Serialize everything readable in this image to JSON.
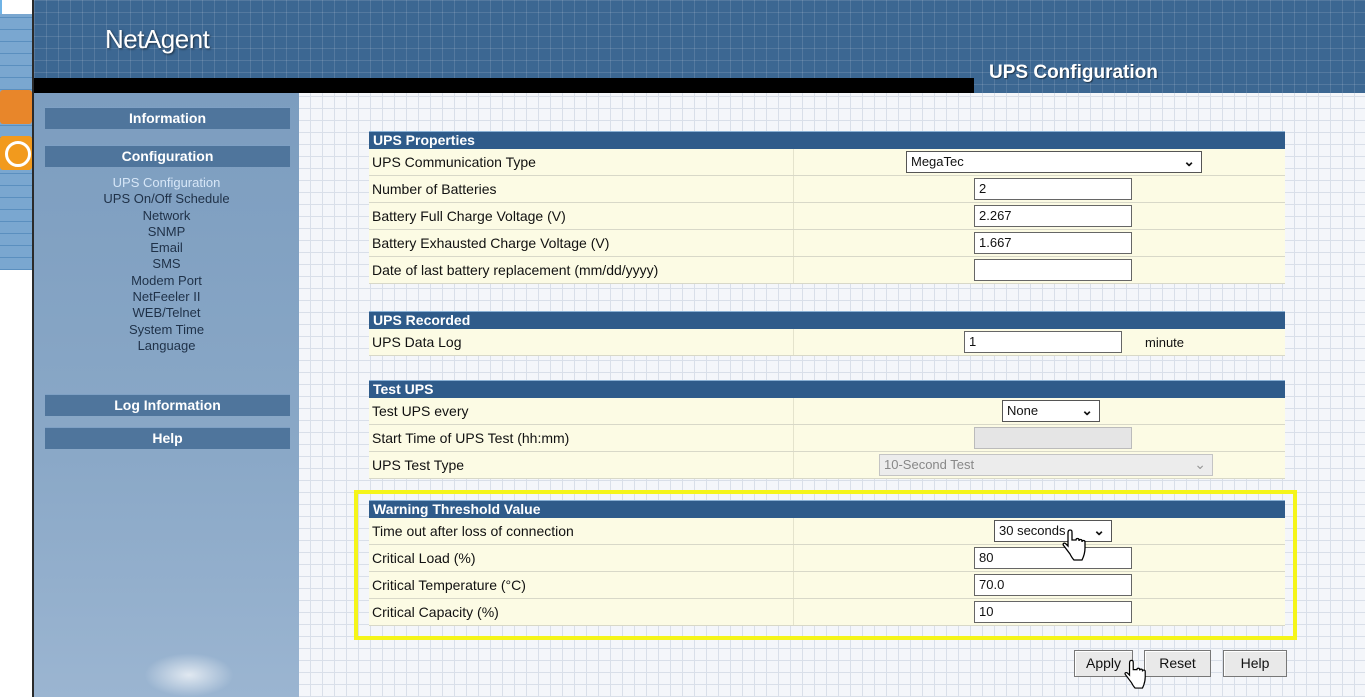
{
  "app": {
    "logo": "NetAgent",
    "page_title": "UPS Configuration"
  },
  "sidebar": {
    "headers": {
      "information": "Information",
      "configuration": "Configuration",
      "log_information": "Log Information",
      "help": "Help"
    },
    "config_links": [
      "UPS Configuration",
      "UPS On/Off Schedule",
      "Network",
      "SNMP",
      "Email",
      "SMS",
      "Modem Port",
      "NetFeeler II",
      "WEB/Telnet",
      "System Time",
      "Language"
    ],
    "active_link": "UPS Configuration"
  },
  "ups_properties": {
    "title": "UPS Properties",
    "communication_type_label": "UPS Communication Type",
    "communication_type_value": "MegaTec",
    "num_batteries_label": "Number of Batteries",
    "num_batteries_value": "2",
    "full_charge_label": "Battery Full Charge Voltage (V)",
    "full_charge_value": "2.267",
    "exhausted_label": "Battery Exhausted Charge Voltage (V)",
    "exhausted_value": "1.667",
    "replacement_date_label": "Date of last battery replacement (mm/dd/yyyy)",
    "replacement_date_value": ""
  },
  "ups_recorded": {
    "title": "UPS Recorded",
    "data_log_label": "UPS Data Log",
    "data_log_value": "1",
    "data_log_unit": "minute"
  },
  "test_ups": {
    "title": "Test UPS",
    "every_label": "Test UPS every",
    "every_value": "None",
    "start_time_label": "Start Time of UPS Test (hh:mm)",
    "start_time_value": "",
    "test_type_label": "UPS Test Type",
    "test_type_value": "10-Second Test"
  },
  "warning_threshold": {
    "title": "Warning Threshold Value",
    "timeout_label": "Time out after loss of connection",
    "timeout_value": "30 seconds",
    "critical_load_label": "Critical Load (%)",
    "critical_load_value": "80",
    "critical_temp_label": "Critical Temperature (°C)",
    "critical_temp_value": "70.0",
    "critical_capacity_label": "Critical Capacity (%)",
    "critical_capacity_value": "10"
  },
  "buttons": {
    "apply": "Apply",
    "reset": "Reset",
    "help": "Help"
  },
  "colors": {
    "header": "#3c6792",
    "section_head": "#2f5b8a",
    "row_bg": "#fcfbe4",
    "highlight": "#f5f51a"
  }
}
